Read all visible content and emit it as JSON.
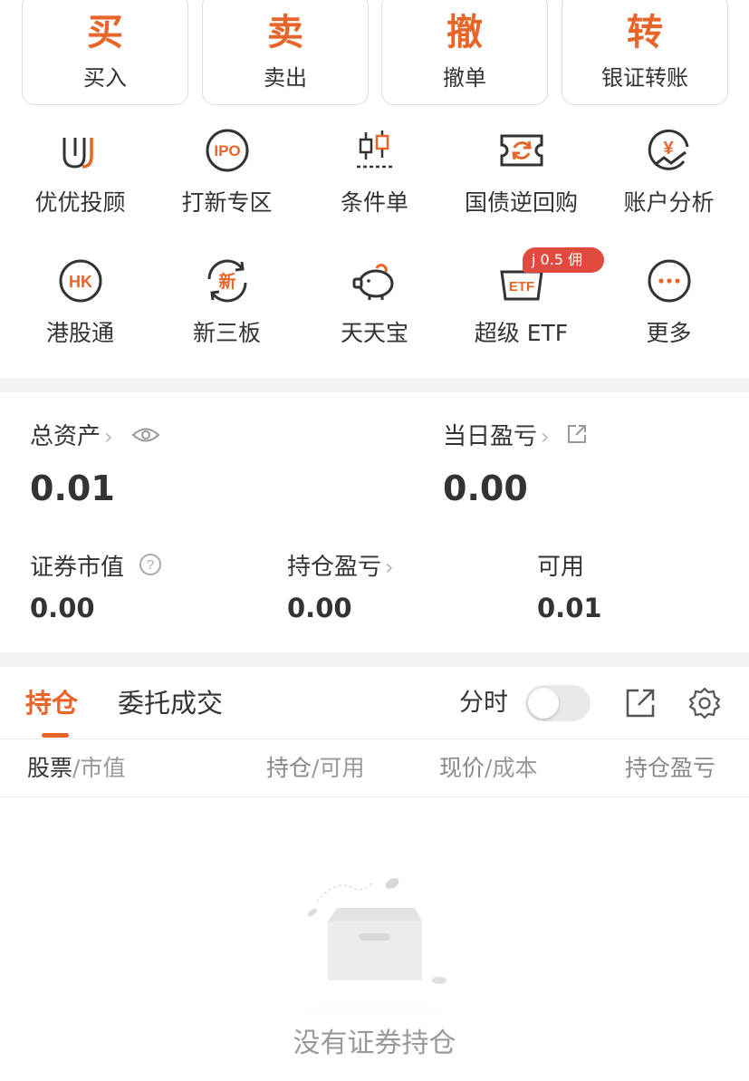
{
  "trade": [
    {
      "char": "买",
      "label": "买入"
    },
    {
      "char": "卖",
      "label": "卖出"
    },
    {
      "char": "撤",
      "label": "撤单"
    },
    {
      "char": "转",
      "label": "银证转账"
    }
  ],
  "features_row1": [
    {
      "icon": "advisor-icon",
      "label": "优优投顾"
    },
    {
      "icon": "ipo-icon",
      "label": "打新专区"
    },
    {
      "icon": "candlestick-icon",
      "label": "条件单"
    },
    {
      "icon": "ticket-refresh-icon",
      "label": "国债逆回购"
    },
    {
      "icon": "yen-chart-icon",
      "label": "账户分析"
    }
  ],
  "features_row2": [
    {
      "icon": "hk-icon",
      "label": "港股通"
    },
    {
      "icon": "new-board-icon",
      "label": "新三板"
    },
    {
      "icon": "piggy-bank-icon",
      "label": "天天宝"
    },
    {
      "icon": "etf-basket-icon",
      "label": "超级 ETF"
    },
    {
      "icon": "more-icon",
      "label": "更多"
    }
  ],
  "etf_badge": "j 0.5  佣",
  "assets": {
    "total_label": "总资产",
    "total_value": "0.01",
    "daily_pl_label": "当日盈亏",
    "daily_pl_value": "0.00",
    "market_value_label": "证券市值",
    "market_value": "0.00",
    "position_pl_label": "持仓盈亏",
    "position_pl_value": "0.00",
    "available_label": "可用",
    "available_value": "0.01"
  },
  "tabs": {
    "holdings": "持仓",
    "orders": "委托成交",
    "toggle_label": "分时",
    "toggle_on": false
  },
  "columns": [
    {
      "a": "股票",
      "b": "市值"
    },
    {
      "a": "持仓",
      "b": "可用"
    },
    {
      "a": "现价",
      "b": "成本"
    },
    {
      "a": "持仓盈亏",
      "b": ""
    }
  ],
  "empty_text": "没有证券持仓",
  "colors": {
    "accent": "#e8652a",
    "badge": "#e04a3f",
    "text": "#333333",
    "muted": "#999999"
  }
}
